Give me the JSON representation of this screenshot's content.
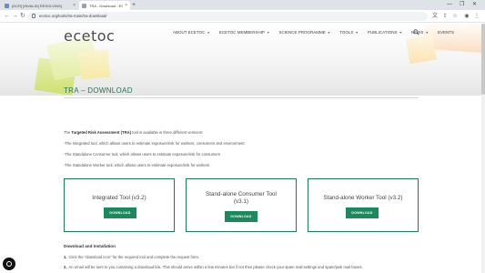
{
  "browser": {
    "tabs": [
      {
        "label": "[OCR] [INVALID] RESOLVING]",
        "favicon_color": "#6b8cc7"
      },
      {
        "label": "TRA - Download - ECETOC",
        "favicon_color": "#9aa2ad",
        "active": true
      }
    ],
    "new_tab": "+",
    "url": "ecetoc.org/tools/tra-main/tra-download/",
    "window_controls": [
      "—",
      "❐",
      "✕"
    ]
  },
  "site": {
    "logo": "ecetoc",
    "nav": [
      {
        "label": "ABOUT ECETOC",
        "caret": true
      },
      {
        "label": "ECETOC MEMBERSHIP",
        "caret": true
      },
      {
        "label": "SCIENCE PROGRAMME",
        "caret": true
      },
      {
        "label": "TOOLS",
        "caret": true
      },
      {
        "label": "PUBLICATIONS",
        "caret": true
      },
      {
        "label": "NEWS",
        "caret": true
      },
      {
        "label": "EVENTS",
        "caret": false
      }
    ]
  },
  "main": {
    "title": "TRA – DOWNLOAD",
    "intro_prefix": "The ",
    "intro_bold": "Targeted Risk Assessment (TRA)",
    "intro_suffix": " tool is available in three different versions:",
    "versions": [
      "-The Integrated tool, which allows users to estimate exposure/risk for workers, consumers and environment",
      "-The Standalone Consumer tool, which allows users to estimate exposure/risk for consumers",
      "-The Standalone Worker tool, which allows users to estimate exposure/risk for workers"
    ],
    "cards": [
      {
        "title": "Integrated Tool (v3.2)",
        "button": "DOWNLOAD"
      },
      {
        "title": "Stand-alone Consumer Tool (v3.1)",
        "button": "DOWNLOAD"
      },
      {
        "title": "Stand-alone Worker Tool (v3.2)",
        "button": "DOWNLOAD"
      }
    ],
    "download_heading": "Download and Installation",
    "steps": [
      {
        "num": "1.",
        "text": "Click the \"download icon\" for the required tool and complete the request form."
      },
      {
        "num": "2.",
        "text": "An email will be sent to you containing a download link. This should arrive within a few minutes but if not then please check your spam mail settings and spam/junk mail boxes."
      }
    ]
  },
  "colors": {
    "accent": "#1c7a5b",
    "button": "#1a8a5e"
  }
}
